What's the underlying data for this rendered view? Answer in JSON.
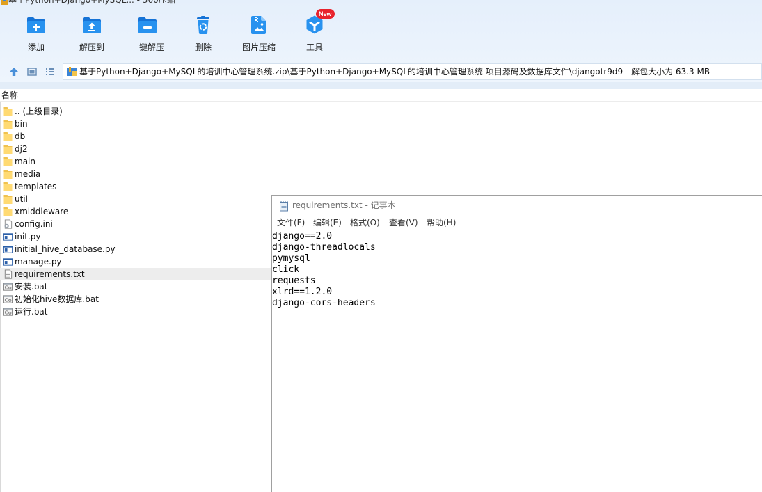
{
  "window": {
    "title": "基于Python+Django+MySQL... - 360压缩"
  },
  "toolbar": {
    "buttons": [
      {
        "label": "添加",
        "icon": "add-folder-icon"
      },
      {
        "label": "解压到",
        "icon": "extract-to-icon"
      },
      {
        "label": "一键解压",
        "icon": "one-click-extract-icon"
      },
      {
        "label": "删除",
        "icon": "trash-icon"
      },
      {
        "label": "图片压缩",
        "icon": "image-compress-icon"
      },
      {
        "label": "工具",
        "icon": "tools-icon"
      }
    ],
    "tools_badge": "New"
  },
  "address": {
    "path": "基于Python+Django+MySQL的培训中心管理系统.zip\\基于Python+Django+MySQL的培训中心管理系统 项目源码及数据库文件\\djangotr9d9 - 解包大小为 63.3 MB"
  },
  "file_list": {
    "header": "名称",
    "items": [
      {
        "name": ".. (上级目录)",
        "icon": "folder-icon"
      },
      {
        "name": "bin",
        "icon": "folder-icon"
      },
      {
        "name": "db",
        "icon": "folder-icon"
      },
      {
        "name": "dj2",
        "icon": "folder-icon"
      },
      {
        "name": "main",
        "icon": "folder-icon"
      },
      {
        "name": "media",
        "icon": "folder-icon"
      },
      {
        "name": "templates",
        "icon": "folder-icon"
      },
      {
        "name": "util",
        "icon": "folder-icon"
      },
      {
        "name": "xmiddleware",
        "icon": "folder-icon"
      },
      {
        "name": "config.ini",
        "icon": "ini-file-icon"
      },
      {
        "name": "init.py",
        "icon": "python-file-icon"
      },
      {
        "name": "initial_hive_database.py",
        "icon": "python-file-icon"
      },
      {
        "name": "manage.py",
        "icon": "python-file-icon"
      },
      {
        "name": "requirements.txt",
        "icon": "text-file-icon",
        "selected": true
      },
      {
        "name": "安装.bat",
        "icon": "batch-file-icon"
      },
      {
        "name": "初始化hive数据库.bat",
        "icon": "batch-file-icon"
      },
      {
        "name": "运行.bat",
        "icon": "batch-file-icon"
      }
    ]
  },
  "notepad": {
    "title": "requirements.txt - 记事本",
    "menu": [
      "文件(F)",
      "编辑(E)",
      "格式(O)",
      "查看(V)",
      "帮助(H)"
    ],
    "lines": [
      "django==2.0",
      "django-threadlocals",
      "pymysql",
      "click",
      "requests",
      "xlrd==1.2.0",
      "django-cors-headers"
    ]
  },
  "colors": {
    "toolbar_icon": "#2892ef",
    "toolbar_bg": "#e9f2fc",
    "folder": "#ffda73",
    "selected_row": "#ededed",
    "badge": "#e8232d"
  }
}
